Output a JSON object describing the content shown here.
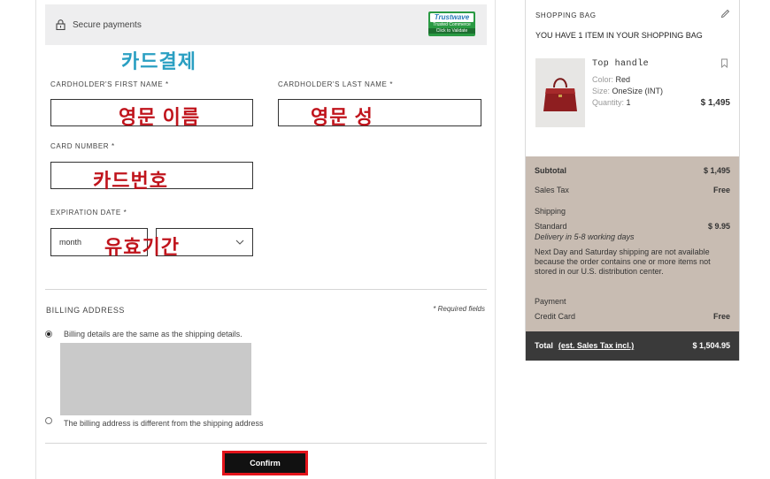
{
  "payment": {
    "secure_label": "Secure payments",
    "trust_badge": {
      "line1": "Trustwave",
      "line2": "Trusted Commerce",
      "line3": "Click to Validate"
    },
    "annotation_card_payment": "카드결제",
    "first_name": {
      "label": "CARDHOLDER'S FIRST NAME *",
      "annotation": "영문 이름"
    },
    "last_name": {
      "label": "CARDHOLDER'S LAST NAME *",
      "annotation": "영문 성"
    },
    "card_number": {
      "label": "CARD NUMBER *",
      "annotation": "카드번호"
    },
    "expiration": {
      "label": "EXPIRATION DATE *",
      "month_value": "month",
      "annotation": "유효기간"
    },
    "billing": {
      "heading": "BILLING ADDRESS",
      "required_note": "* Required fields",
      "option_same": "Billing details are the same as the shipping details.",
      "option_different": "The billing address is different from the shipping address"
    },
    "confirm_label": "Confirm"
  },
  "bag": {
    "title": "SHOPPING BAG",
    "subtitle": "YOU HAVE 1 ITEM IN YOUR SHOPPING BAG",
    "item": {
      "name": "Top handle",
      "color_label": "Color:",
      "color_value": "Red",
      "size_label": "Size:",
      "size_value": "OneSize (INT)",
      "qty_label": "Quantity:",
      "qty_value": "1",
      "price": "$ 1,495"
    },
    "summary": {
      "subtotal_label": "Subtotal",
      "subtotal_value": "$ 1,495",
      "tax_label": "Sales Tax",
      "tax_value": "Free",
      "shipping_label": "Shipping",
      "standard_label": "Standard",
      "standard_value": "$ 9.95",
      "delivery_note": "Delivery in 5-8 working days",
      "shipping_note": "Next Day and Saturday shipping are not available because the order contains one or more items not stored in our U.S. distribution center.",
      "payment_label": "Payment",
      "credit_label": "Credit Card",
      "credit_value": "Free"
    },
    "total": {
      "label": "Total",
      "tax_link": "(est. Sales Tax incl.)",
      "value": "$ 1,504.95"
    }
  },
  "colors": {
    "annotation_red": "#c0141c",
    "annotation_teal": "#2a9fc2",
    "summary_bg": "#c8bcb2",
    "total_bg": "#3a3a3a",
    "confirm_border": "#e3141b"
  }
}
